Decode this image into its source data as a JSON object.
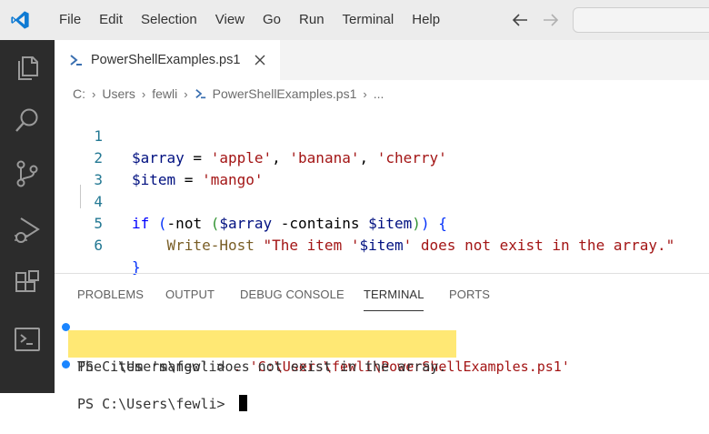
{
  "menu": {
    "items": [
      "File",
      "Edit",
      "Selection",
      "View",
      "Go",
      "Run",
      "Terminal",
      "Help"
    ]
  },
  "titlebar": {
    "back_icon": "arrow-left-icon",
    "forward_icon": "arrow-right-icon"
  },
  "activity_bar": {
    "icons": [
      "explorer-icon",
      "search-icon",
      "source-control-icon",
      "run-debug-icon",
      "extensions-icon",
      "terminal-icon"
    ]
  },
  "tab": {
    "label": "PowerShellExamples.ps1"
  },
  "breadcrumb": {
    "parts": [
      "C:",
      "Users",
      "fewli",
      "PowerShellExamples.ps1",
      "..."
    ]
  },
  "editor": {
    "line_numbers": [
      "1",
      "2",
      "3",
      "4",
      "5",
      "6"
    ],
    "lines": [
      "$array = 'apple', 'banana', 'cherry'",
      "$item = 'mango'",
      "",
      "if (-not ($array -contains $item)) {",
      "    Write-Host \"The item '$item' does not exist in the array.\"",
      "}"
    ]
  },
  "panel": {
    "tabs": [
      "PROBLEMS",
      "OUTPUT",
      "DEBUG CONSOLE",
      "TERMINAL",
      "PORTS"
    ],
    "active_tab": "TERMINAL"
  },
  "terminal": {
    "prompt1": "PS C:\\Users\\fewli> ",
    "command": ". 'C:\\Users\\fewli\\PowerShellExamples.ps1'",
    "output": "The item 'mango' does not exist in the array.",
    "prompt2": "PS C:\\Users\\fewli> "
  },
  "colors": {
    "activity_bar": "#2c2c2c",
    "accent_blue": "#007acc",
    "highlight": "#ffe45c"
  }
}
